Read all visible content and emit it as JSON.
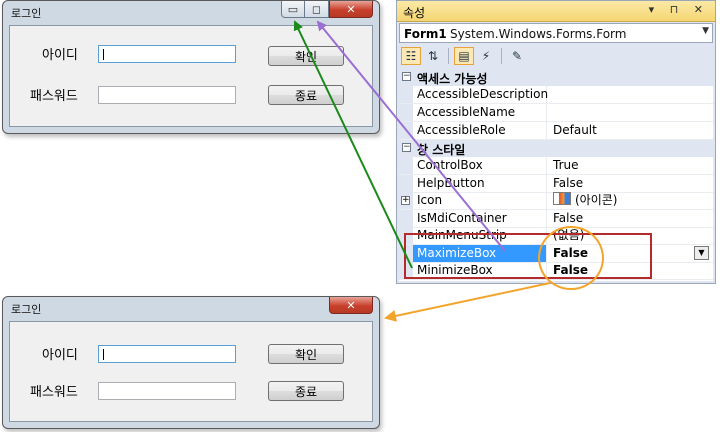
{
  "top_window": {
    "title": "로그인",
    "caption_min": "▭",
    "caption_max": "◻",
    "caption_close": "✕",
    "id_label": "아이디",
    "pw_label": "패스워드",
    "id_value": "",
    "pw_value": "",
    "ok_button": "확인",
    "exit_button": "종료"
  },
  "bottom_window": {
    "title": "로그인",
    "caption_close": "✕",
    "id_label": "아이디",
    "pw_label": "패스워드",
    "id_value": "",
    "pw_value": "",
    "ok_button": "확인",
    "exit_button": "종료"
  },
  "properties": {
    "title": "속성",
    "header_icons": "▾ ⊓ ✕",
    "object_name": "Form1",
    "object_type": "System.Windows.Forms.Form",
    "categories": [
      {
        "label": "액세스 가능성",
        "rows": [
          {
            "name": "AccessibleDescription",
            "value": ""
          },
          {
            "name": "AccessibleName",
            "value": ""
          },
          {
            "name": "AccessibleRole",
            "value": "Default"
          }
        ]
      },
      {
        "label": "창 스타일",
        "rows": [
          {
            "name": "ControlBox",
            "value": "True"
          },
          {
            "name": "HelpButton",
            "value": "False"
          },
          {
            "name": "Icon",
            "value": "(아이콘)"
          },
          {
            "name": "IsMdiContainer",
            "value": "False"
          },
          {
            "name": "MainMenuStrip",
            "value": "(없음)"
          },
          {
            "name": "MaximizeBox",
            "value": "False"
          },
          {
            "name": "MinimizeBox",
            "value": "False"
          }
        ]
      }
    ]
  },
  "colors": {
    "green_arrow": "#1a8a1a",
    "purple_arrow": "#9b6fd1",
    "orange_arrow": "#f3a42a",
    "highlight_box": "#b52b2b"
  }
}
